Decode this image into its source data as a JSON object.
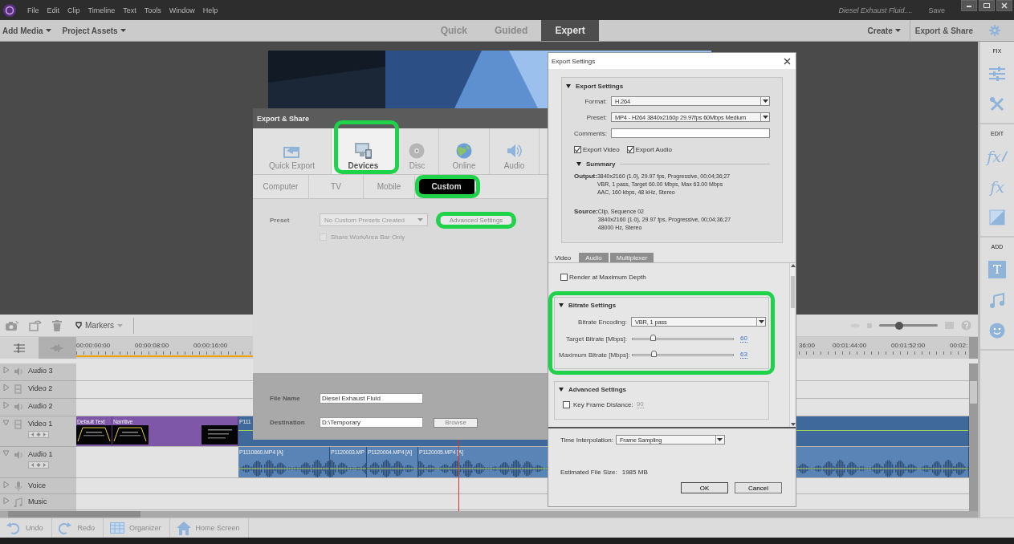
{
  "menu_bar": {
    "items": [
      "File",
      "Edit",
      "Clip",
      "Timeline",
      "Text",
      "Tools",
      "Window",
      "Help"
    ],
    "document_title": "Diesel Exhaust Fluid....",
    "save": "Save"
  },
  "toolbar": {
    "menus": [
      "Add Media",
      "Project Assets"
    ],
    "modes": [
      {
        "label": "Quick",
        "selected": false
      },
      {
        "label": "Guided",
        "selected": false
      },
      {
        "label": "Expert",
        "selected": true
      }
    ],
    "create": "Create",
    "export_share": "Export & Share"
  },
  "right_panel": {
    "sections": [
      {
        "title": "FIX",
        "tools": [
          {
            "kind": "adjust"
          },
          {
            "kind": "tools"
          }
        ]
      },
      {
        "title": "EDIT",
        "tools": [
          {
            "kind": "fx_edit",
            "glyph": "fx"
          },
          {
            "kind": "fx",
            "glyph": "fx"
          },
          {
            "kind": "transition"
          }
        ]
      },
      {
        "title": "ADD",
        "tools": [
          {
            "kind": "title",
            "glyph": "T"
          },
          {
            "kind": "music"
          },
          {
            "kind": "graphics"
          }
        ]
      }
    ]
  },
  "timeline": {
    "markers": "Markers",
    "zoom": {
      "level": 0.34
    },
    "ruler_start": [
      "00:00:00:00",
      "00:00:08:00",
      "00:00:16:00"
    ],
    "ruler_end": [
      "36:00",
      "00:01:44:00",
      "00:01:52:00",
      "00:02:"
    ],
    "tracks": [
      {
        "name": "Audio 3",
        "kind": "audio",
        "expanded": false
      },
      {
        "name": "Video 2",
        "kind": "video",
        "expanded": false
      },
      {
        "name": "Audio 2",
        "kind": "audio",
        "expanded": false
      },
      {
        "name": "Video 1",
        "kind": "video",
        "expanded": true,
        "clips": [
          {
            "label": "Default Text",
            "kind": "title"
          },
          {
            "label": "Narritive",
            "kind": "title"
          },
          {
            "label": "P111",
            "kind": "video"
          }
        ]
      },
      {
        "name": "Audio 1",
        "kind": "audio",
        "expanded": true,
        "clips": [
          {
            "label": "P1110860.MP4 [A]",
            "kind": "audio"
          },
          {
            "label": "P1120003.MP",
            "kind": "audio"
          },
          {
            "label": "P1120004.MP4 [A]",
            "kind": "audio"
          },
          {
            "label": "P1120005.MP4 [A]",
            "kind": "audio"
          }
        ]
      },
      {
        "name": "Voice",
        "kind": "voice",
        "expanded": false
      },
      {
        "name": "Music",
        "kind": "music",
        "expanded": false
      }
    ]
  },
  "bottom_bar": [
    {
      "label": "Undo",
      "kind": "undo"
    },
    {
      "label": "Redo",
      "kind": "redo"
    },
    {
      "label": "Organizer",
      "kind": "organizer"
    },
    {
      "label": "Home Screen",
      "kind": "home"
    }
  ],
  "export_share": {
    "title": "Export & Share",
    "categories": [
      {
        "label": "Quick Export",
        "kind": "quick",
        "selected": false,
        "highlighted": false
      },
      {
        "label": "Devices",
        "kind": "devices",
        "selected": true,
        "highlighted": true
      },
      {
        "label": "Disc",
        "kind": "disc",
        "selected": false,
        "highlighted": false
      },
      {
        "label": "Online",
        "kind": "online",
        "selected": false,
        "highlighted": false
      },
      {
        "label": "Audio",
        "kind": "audio",
        "selected": false,
        "highlighted": false
      }
    ],
    "formats": [
      {
        "label": "Computer",
        "selected": false,
        "highlighted": false
      },
      {
        "label": "TV",
        "selected": false,
        "highlighted": false
      },
      {
        "label": "Mobile",
        "selected": false,
        "highlighted": false
      },
      {
        "label": "Custom",
        "selected": true,
        "highlighted": true
      }
    ],
    "preset_label": "Preset",
    "preset": "No Custom Presets Created",
    "advanced_button": {
      "label": "Advanced Settings",
      "highlighted": true
    },
    "workarea": {
      "label": "Share WorkArea Bar Only",
      "checked": false
    },
    "file_name_label": "File Name",
    "file_name": "Diesel Exhaust Fluid",
    "destination_label": "Destination",
    "destination": "D:\\Temporary",
    "browse": "Browse"
  },
  "export_settings": {
    "title": "Export Settings",
    "section_title": "Export Settings",
    "format_label": "Format:",
    "format": "H.264",
    "preset_label": "Preset:",
    "preset": "MP4 - H264 3840x2160p 29.97fps 60Mbps Medium",
    "comments_label": "Comments:",
    "exports": [
      {
        "label": "Export Video",
        "checked": true
      },
      {
        "label": "Export Audio",
        "checked": true
      }
    ],
    "summary_title": "Summary",
    "output_label": "Output:",
    "output_lines": [
      "3840x2160 (1.0), 29.97 fps, Progressive, 00;04;36;27",
      "VBR, 1 pass, Target 60.00 Mbps, Max 63.00 Mbps",
      "AAC, 160 kbps, 48 kHz, Stereo"
    ],
    "source_label": "Source:",
    "source_lines": [
      "Clip, Sequence 02",
      "3840x2160 (1.0), 29.97 fps, Progressive, 00;04;36;27",
      "48000 Hz, Stereo"
    ],
    "tabs": [
      {
        "label": "Video",
        "selected": true
      },
      {
        "label": "Audio",
        "selected": false
      },
      {
        "label": "Multiplexer",
        "selected": false
      }
    ],
    "render_max_depth": {
      "label": "Render at Maximum Depth",
      "checked": false
    },
    "bitrate": {
      "title": "Bitrate Settings",
      "highlighted": true,
      "encoding_label": "Bitrate Encoding:",
      "encoding": "VBR, 1 pass",
      "sliders": [
        {
          "label": "Target Bitrate [Mbps]:",
          "level": 0.2,
          "reading": "60"
        },
        {
          "label": "Maximum Bitrate [Mbps]:",
          "level": 0.21,
          "reading": "63"
        }
      ]
    },
    "advanced": {
      "title": "Advanced Settings",
      "key_frame": {
        "label": "Key Frame Distance:",
        "checked": false,
        "value": "90"
      }
    },
    "time_interp_label": "Time Interpolation:",
    "time_interp": "Frame Sampling",
    "file_size_label": "Estimated File Size:",
    "file_size": "1985 MB",
    "ok": "OK",
    "cancel": "Cancel"
  }
}
